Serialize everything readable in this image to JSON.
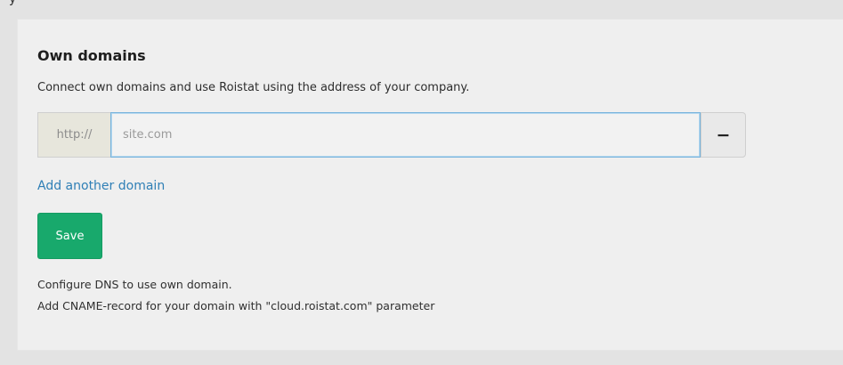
{
  "top_fragment": "y",
  "section": {
    "title": "Own domains",
    "description": "Connect own domains and use Roistat using the address of your company."
  },
  "domain_input": {
    "prefix": "http://",
    "value": "",
    "placeholder": "site.com"
  },
  "remove_button_label": "−",
  "add_domain_link": "Add another domain",
  "save_button_label": "Save",
  "dns_info": {
    "line1": "Configure DNS to use own domain.",
    "line2": "Add CNAME-record for your domain with \"cloud.roistat.com\" parameter"
  },
  "colors": {
    "accent": "#18a96c",
    "link": "#2f7fb6",
    "focus": "#76b3dc"
  }
}
